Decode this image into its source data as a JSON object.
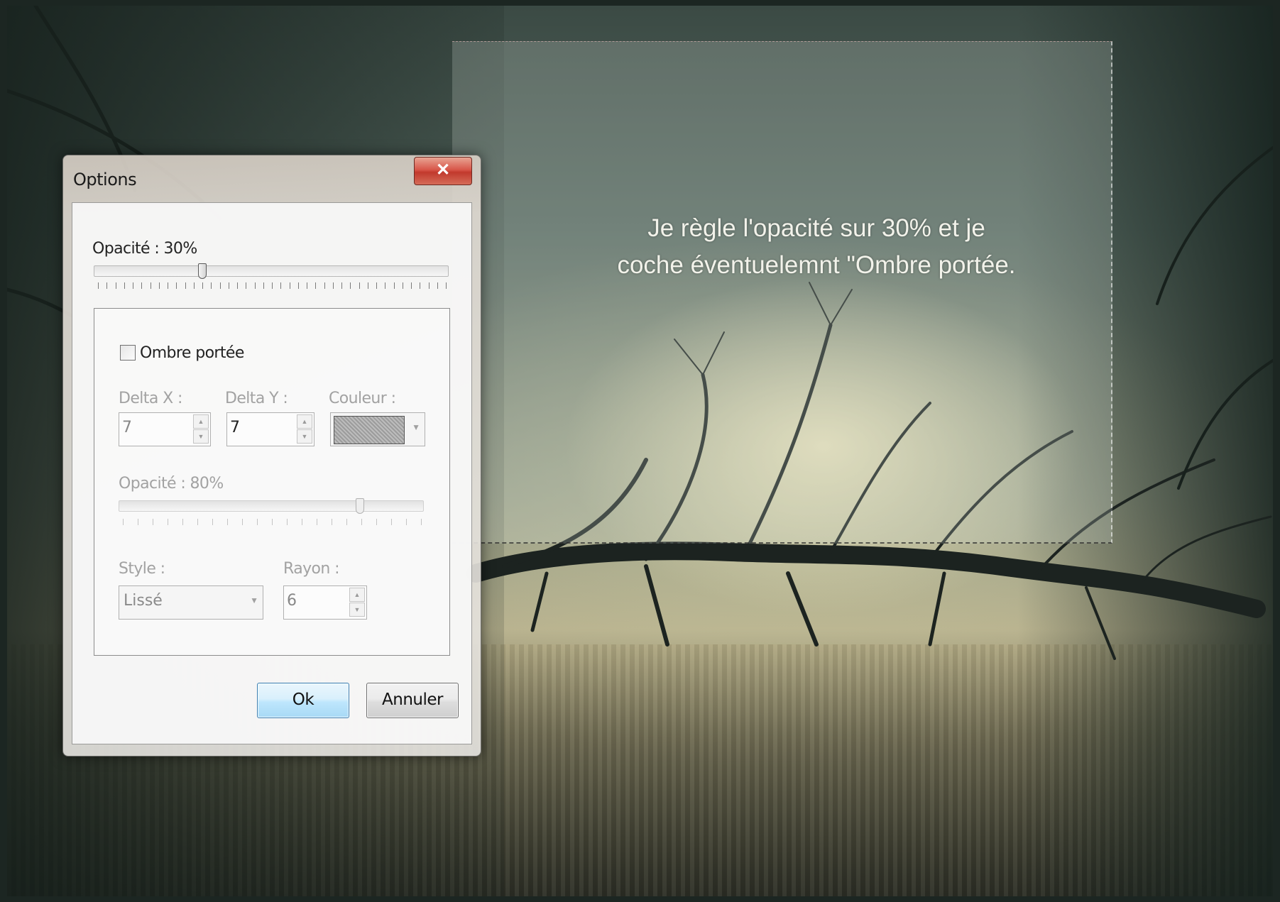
{
  "caption": {
    "line1": "Je règle l'opacité sur 30% et je",
    "line2": "coche éventuelemnt \"Ombre portée."
  },
  "dialog": {
    "title": "Options",
    "close_icon": "close-icon",
    "close_glyph": "✕",
    "opacity_label": "Opacité : 30%",
    "opacity_value": 0.3,
    "shadow": {
      "checkbox_label": "Ombre portée",
      "checked": false,
      "delta_x_label": "Delta X :",
      "delta_x_value": "7",
      "delta_y_label": "Delta Y :",
      "delta_y_value": "7",
      "color_label": "Couleur :",
      "opacity_label": "Opacité : 80%",
      "opacity_value": 0.8,
      "style_label": "Style :",
      "style_value": "Lissé",
      "radius_label": "Rayon :",
      "radius_value": "6",
      "spin_up_icon": "arrow-up-icon",
      "spin_down_icon": "arrow-down-icon",
      "dropdown_icon": "chevron-down-icon"
    },
    "ok_label": "Ok",
    "cancel_label": "Annuler"
  },
  "colors": {
    "ok_button": "#bee6fd",
    "close_button": "#c1392d"
  }
}
